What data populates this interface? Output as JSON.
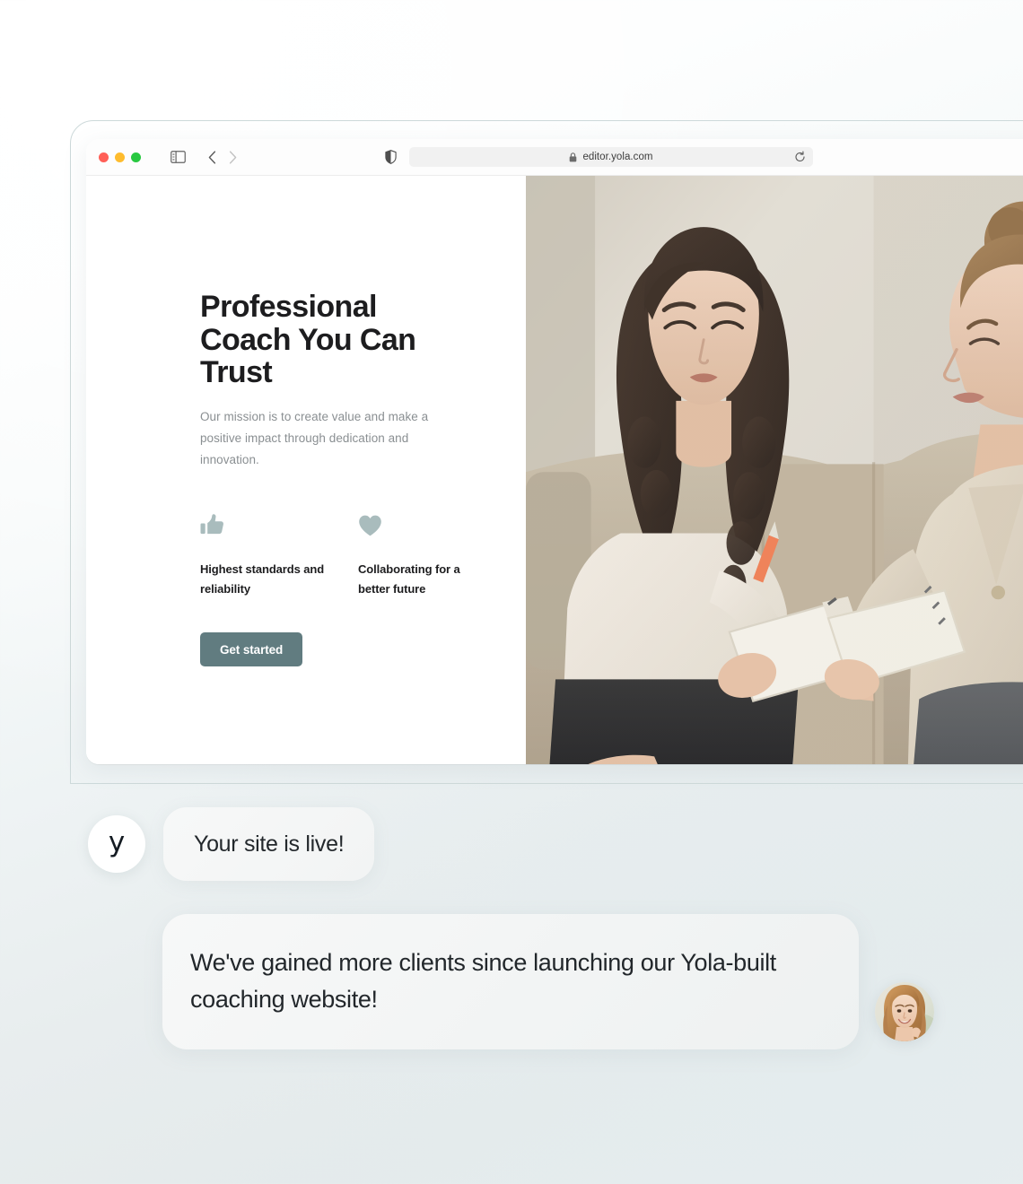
{
  "browser": {
    "traffic_lights": [
      {
        "name": "close",
        "color": "#ff5f57"
      },
      {
        "name": "minimize",
        "color": "#febc2e"
      },
      {
        "name": "zoom",
        "color": "#28c840"
      }
    ],
    "sidebar_toggle_icon": "sidebar-icon",
    "back_icon": "chevron-left-icon",
    "forward_icon": "chevron-right-icon",
    "shield_icon": "shield-icon",
    "lock_icon": "lock-icon",
    "url": "editor.yola.com",
    "reload_icon": "reload-icon"
  },
  "hero": {
    "title": "Professional Coach You Can Trust",
    "subtitle": "Our mission is to create value and make a positive impact through dedication and innovation.",
    "features": [
      {
        "icon": "thumbs-up-icon",
        "label": "Highest standards and reliability"
      },
      {
        "icon": "heart-icon",
        "label": "Collaborating for a better future"
      }
    ],
    "cta_label": "Get started",
    "cta_color": "#617c80",
    "feature_icon_color": "#a9bcbd",
    "photo_alt": "two-women-coaching-session-photo"
  },
  "chat": {
    "brand_initial": "y",
    "messages": [
      {
        "id": "bubble-system",
        "text": "Your site is live!",
        "avatar": "yola-logo-avatar"
      },
      {
        "id": "bubble-testimonial",
        "text": "We've gained more clients since launching our Yola-built coaching website!",
        "avatar": "user-photo-avatar"
      }
    ]
  },
  "theme": {
    "page_background": "#e7ecee",
    "bezel_border": "#cdd9da",
    "window_background": "#ffffff",
    "bubble_background": "#f4f6f6",
    "heading_color": "#1d1d1f",
    "body_text_color": "#8a8f92"
  }
}
